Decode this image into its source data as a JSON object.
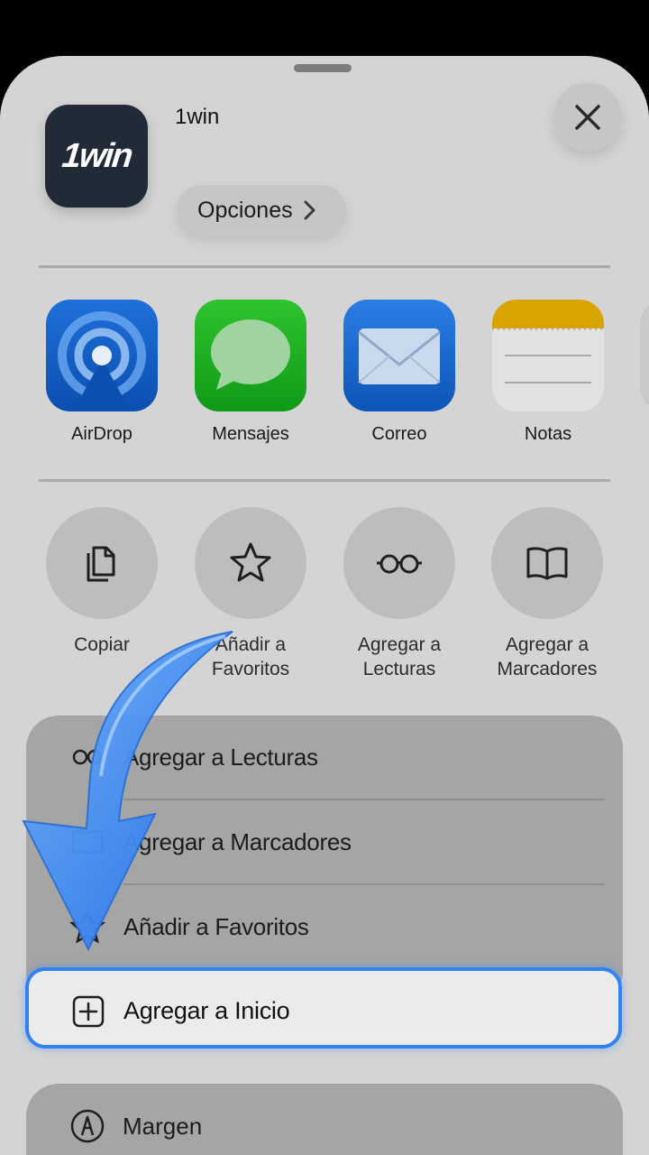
{
  "app": {
    "name": "1win",
    "icon_text": "1win",
    "options_label": "Opciones"
  },
  "share_apps": [
    {
      "label": "AirDrop"
    },
    {
      "label": "Mensajes"
    },
    {
      "label": "Correo"
    },
    {
      "label": "Notas"
    }
  ],
  "actions": [
    {
      "label_line1": "Copiar",
      "label_line2": ""
    },
    {
      "label_line1": "Añadir a",
      "label_line2": "Favoritos"
    },
    {
      "label_line1": "Agregar a",
      "label_line2": "Lecturas"
    },
    {
      "label_line1": "Agregar a",
      "label_line2": "Marcadores"
    }
  ],
  "menu": {
    "items": [
      {
        "label": "Agregar a Lecturas"
      },
      {
        "label": "Agregar a Marcadores"
      },
      {
        "label": "Añadir a Favoritos"
      }
    ],
    "highlighted": {
      "label": "Agregar a Inicio"
    },
    "second_card": {
      "label": "Margen"
    }
  },
  "colors": {
    "highlight_border": "#2f82f4",
    "arrow": "#3f8ef6"
  }
}
